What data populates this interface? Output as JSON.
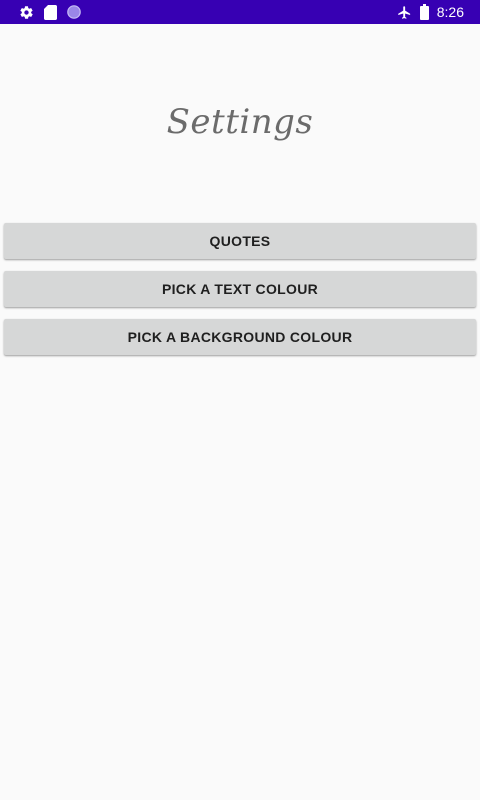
{
  "status_bar": {
    "time": "8:26",
    "background_color": "#3700b3",
    "left_icons": [
      "settings-icon",
      "sim-card-icon",
      "circle-notification-icon"
    ],
    "right_icons": [
      "airplane-mode-icon",
      "battery-icon"
    ]
  },
  "page": {
    "title": "Settings",
    "background_color": "#fafafa"
  },
  "buttons": [
    {
      "label": "QUOTES"
    },
    {
      "label": "PICK A TEXT COLOUR"
    },
    {
      "label": "PICK A BACKGROUND COLOUR"
    }
  ],
  "colors": {
    "button_background": "#d6d7d7",
    "button_text": "#1f1f1f",
    "title_text": "#6b6b6b"
  }
}
